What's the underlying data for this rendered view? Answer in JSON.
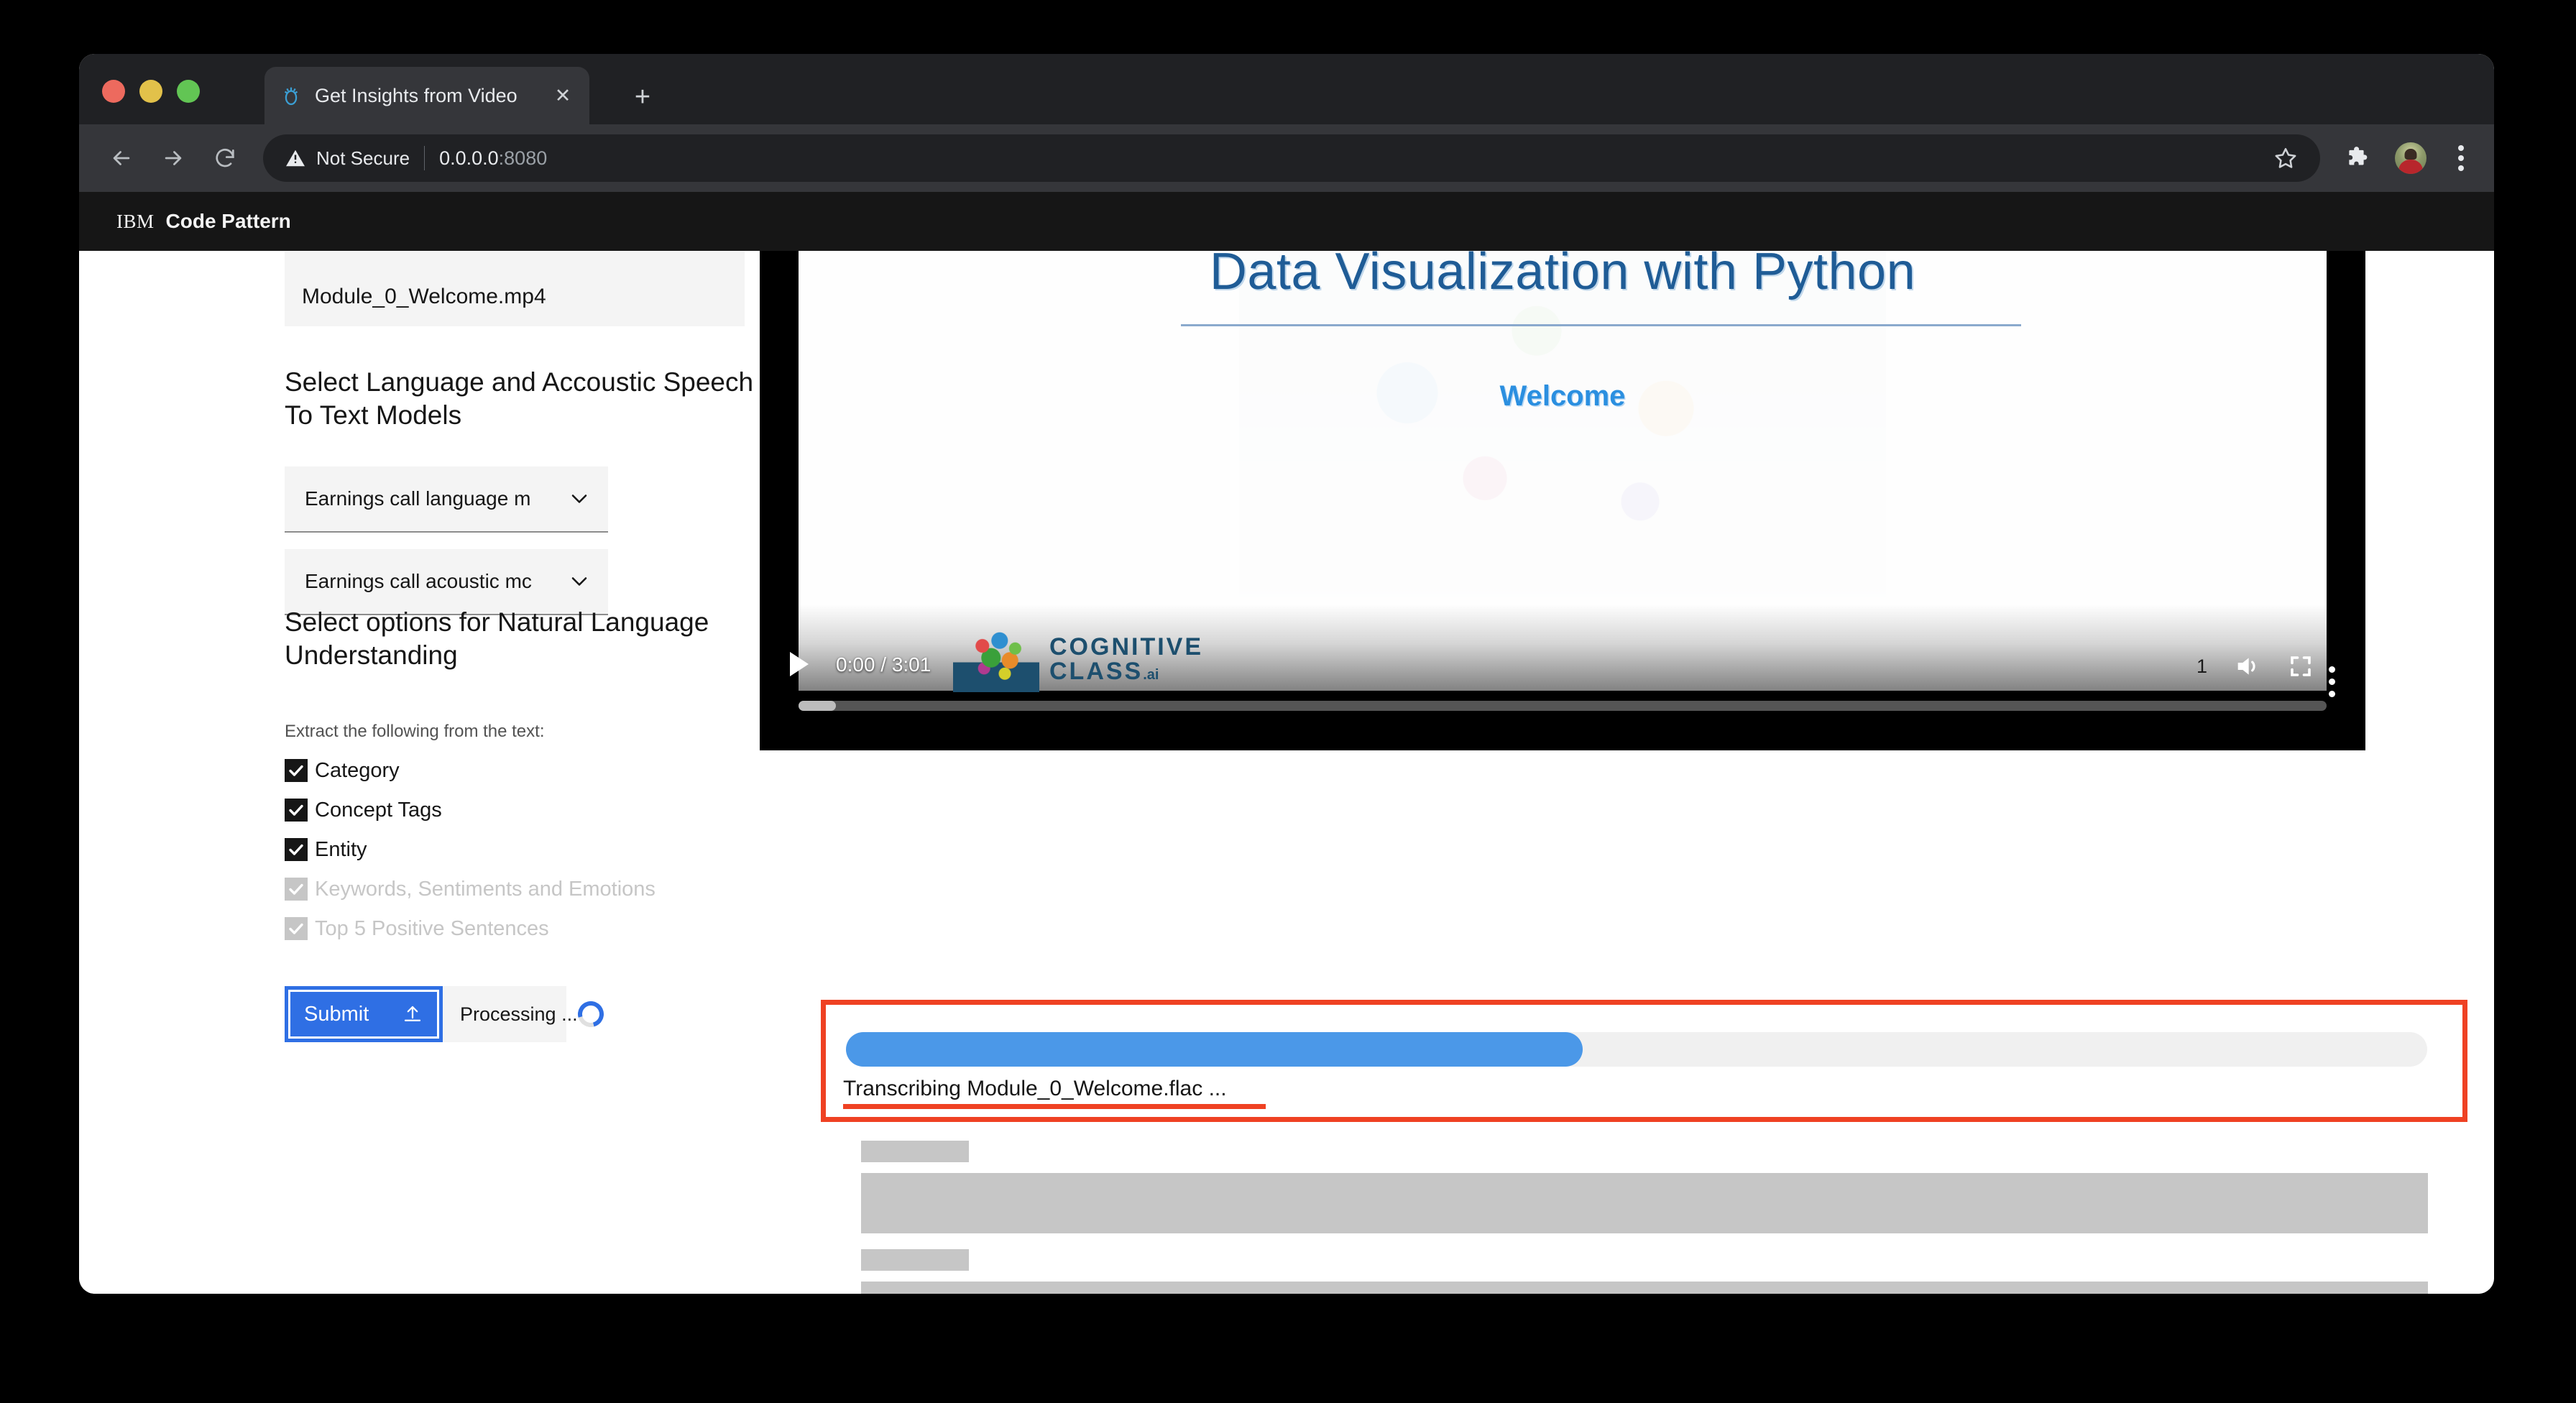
{
  "browser": {
    "tab": {
      "title": "Get Insights from Video",
      "favicon_icon": "lightbulb-idea-icon",
      "close_icon": "close-icon"
    },
    "new_tab_label": "+",
    "nav": {
      "back_icon": "back-arrow-icon",
      "forward_icon": "forward-arrow-icon",
      "reload_icon": "reload-icon"
    },
    "omnibox": {
      "security_icon": "warning-triangle-icon",
      "security_label": "Not Secure",
      "url_host": "0.0.0.0",
      "url_port": ":8080",
      "bookmark_icon": "star-icon"
    },
    "extensions_icon": "puzzle-piece-icon",
    "profile_icon": "avatar",
    "menu_icon": "kebab-menu-icon"
  },
  "page_header": {
    "brand": "IBM",
    "title": "Code Pattern"
  },
  "form": {
    "file_name": "Module_0_Welcome.mp4",
    "models_section_title": "Select Language and Accoustic Speech To Text Models",
    "language_model": "Earnings call language m",
    "acoustic_model": "Earnings call acoustic mc",
    "chevron_icon": "chevron-down-icon",
    "nlu_section_title": "Select options for Natural Language Understanding",
    "extract_hint": "Extract the following from the text:",
    "options": [
      {
        "label": "Category",
        "checked": true,
        "disabled": false
      },
      {
        "label": "Concept Tags",
        "checked": true,
        "disabled": false
      },
      {
        "label": "Entity",
        "checked": true,
        "disabled": false
      },
      {
        "label": "Keywords, Sentiments and Emotions",
        "checked": true,
        "disabled": true
      },
      {
        "label": "Top 5 Positive Sentences",
        "checked": true,
        "disabled": true
      }
    ],
    "submit_label": "Submit",
    "submit_icon": "upload-icon",
    "processing_label": "Processing ...",
    "spinner_icon": "loading-spinner-icon",
    "accent_color": "#2f6fe4"
  },
  "video": {
    "slide_title": "Data Visualization with Python",
    "slide_subtitle": "Welcome",
    "play_icon": "play-icon",
    "time_display": "0:00 / 3:01",
    "logo_line1": "COGNITIVE",
    "logo_line2": "CLASS",
    "logo_suffix": ".ai",
    "playback_speed": "1",
    "volume_icon": "volume-icon",
    "fullscreen_icon": "fullscreen-icon",
    "more_icon": "kebab-menu-icon"
  },
  "progress": {
    "status_text": "Transcribing Module_0_Welcome.flac ...",
    "percent": 46,
    "bar_color": "#4b98e8",
    "highlight_color": "#ef4123"
  }
}
